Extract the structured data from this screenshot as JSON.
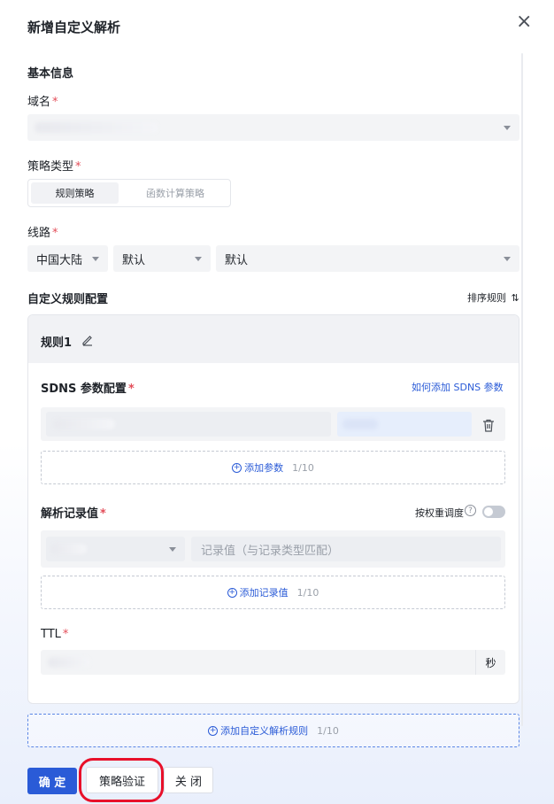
{
  "dialog": {
    "title": "新增自定义解析",
    "close_icon": "×"
  },
  "basic": {
    "section_title": "基本信息",
    "domain_label": "域名",
    "required_mark": "*"
  },
  "strategy": {
    "label": "策略类型",
    "options": [
      "规则策略",
      "函数计算策略"
    ],
    "selected": "规则策略"
  },
  "line": {
    "label": "线路",
    "values": [
      "中国大陆",
      "默认",
      "默认"
    ]
  },
  "custom_rules": {
    "section_title": "自定义规则配置",
    "sort_label": "排序规则",
    "sort_icon": "⇅"
  },
  "rule": {
    "title": "规则1",
    "sdns_label": "SDNS 参数配置",
    "sdns_help_link": "如何添加 SDNS 参数",
    "add_param_label": "添加参数",
    "add_param_count": "1/10",
    "record_label": "解析记录值",
    "weight_label": "按权重调度",
    "record_placeholder": "记录值（与记录类型匹配）",
    "add_record_label": "添加记录值",
    "add_record_count": "1/10",
    "ttl_label": "TTL",
    "ttl_unit": "秒"
  },
  "add_rule": {
    "label": "添加自定义解析规则",
    "count": "1/10"
  },
  "footer": {
    "confirm": "确 定",
    "verify": "策略验证",
    "close": "关 闭"
  },
  "colors": {
    "primary": "#2a5bd7",
    "required": "#e34d59",
    "highlight_ring": "#e8102a"
  }
}
